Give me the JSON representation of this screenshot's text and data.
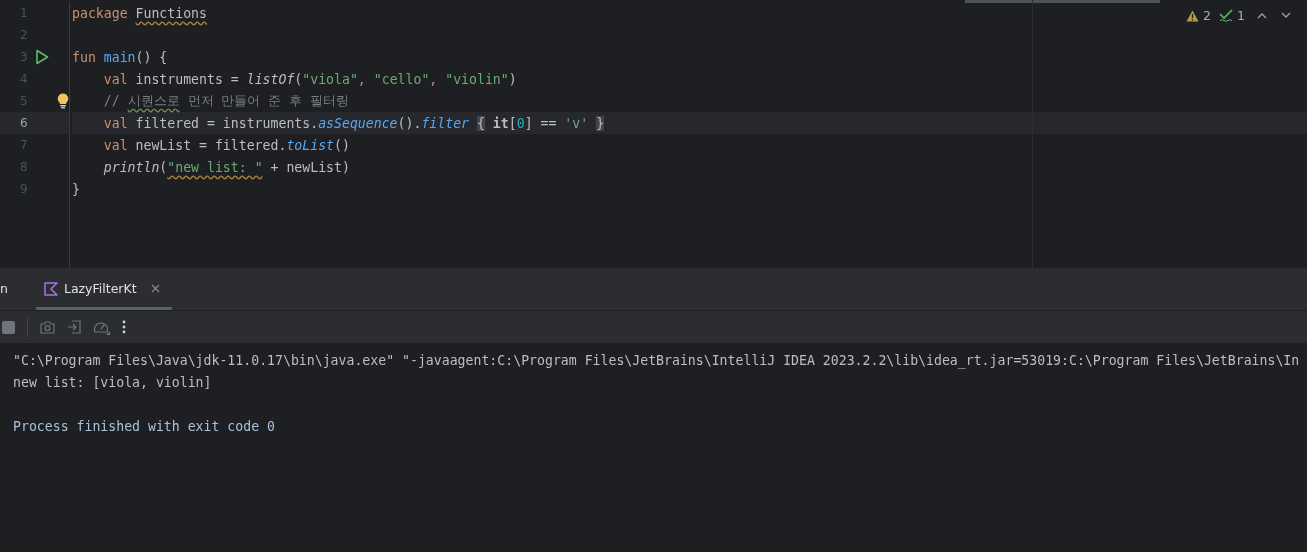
{
  "editor": {
    "inspections": {
      "warnings": "2",
      "weak_warnings": "1"
    },
    "lines": [
      {
        "number": "1",
        "current": false,
        "run_marker": false,
        "hint_bulb": false,
        "tokens": [
          {
            "text": "package ",
            "kind": "kw"
          },
          {
            "text": "Functions",
            "kind": "warned"
          }
        ]
      },
      {
        "number": "2",
        "current": false,
        "run_marker": false,
        "hint_bulb": false
      },
      {
        "number": "3",
        "current": false,
        "run_marker": true,
        "hint_bulb": false,
        "tokens": [
          {
            "text": "fun ",
            "kind": "kw"
          },
          {
            "text": "main",
            "kind": "decl"
          },
          {
            "text": "() {",
            "kind": "plain"
          }
        ]
      },
      {
        "number": "4",
        "current": false,
        "run_marker": false,
        "hint_bulb": false,
        "tokens": [
          {
            "text": "    val ",
            "kind": "kw"
          },
          {
            "text": "instruments = ",
            "kind": "plain"
          },
          {
            "text": "listOf",
            "kind": "call"
          },
          {
            "text": "(",
            "kind": "plain"
          },
          {
            "text": "\"viola\"",
            "kind": "str"
          },
          {
            "text": ", ",
            "kind": "kw"
          },
          {
            "text": "\"cello\"",
            "kind": "str"
          },
          {
            "text": ", ",
            "kind": "kw"
          },
          {
            "text": "\"violin\"",
            "kind": "str"
          },
          {
            "text": ")",
            "kind": "plain"
          }
        ]
      },
      {
        "number": "5",
        "current": false,
        "run_marker": false,
        "hint_bulb": true,
        "tokens": [
          {
            "text": "    // ",
            "kind": "comment"
          },
          {
            "text": "시퀀스로",
            "kind": "commenttypo"
          },
          {
            "text": " 먼저 만들어 준 후 필터링",
            "kind": "comment"
          }
        ]
      },
      {
        "number": "6",
        "current": true,
        "run_marker": false,
        "hint_bulb": false,
        "tokens": [
          {
            "text": "    val ",
            "kind": "kw"
          },
          {
            "text": "filtered = instruments.",
            "kind": "plain"
          },
          {
            "text": "asSequence",
            "kind": "ext"
          },
          {
            "text": "().",
            "kind": "plain"
          },
          {
            "text": "filter ",
            "kind": "ext"
          },
          {
            "text": "{",
            "kind": "brace"
          },
          {
            "text": " it",
            "kind": "bold"
          },
          {
            "text": "[",
            "kind": "plain"
          },
          {
            "text": "0",
            "kind": "num"
          },
          {
            "text": "] == ",
            "kind": "plain"
          },
          {
            "text": "'v' ",
            "kind": "str"
          },
          {
            "text": "}",
            "kind": "brace"
          }
        ]
      },
      {
        "number": "7",
        "current": false,
        "run_marker": false,
        "hint_bulb": false,
        "tokens": [
          {
            "text": "    val ",
            "kind": "kw"
          },
          {
            "text": "newList = filtered.",
            "kind": "plain"
          },
          {
            "text": "toList",
            "kind": "ext"
          },
          {
            "text": "()",
            "kind": "plain"
          }
        ]
      },
      {
        "number": "8",
        "current": false,
        "run_marker": false,
        "hint_bulb": false,
        "tokens": [
          {
            "text": "    println",
            "kind": "call"
          },
          {
            "text": "(",
            "kind": "plain"
          },
          {
            "text": "\"new list: \"",
            "kind": "strtypo"
          },
          {
            "text": " + newList)",
            "kind": "plain"
          }
        ]
      },
      {
        "number": "9",
        "current": false,
        "run_marker": false,
        "hint_bulb": false,
        "tokens": [
          {
            "text": "}",
            "kind": "plain"
          }
        ]
      }
    ]
  },
  "run_panel": {
    "tabs": [
      {
        "label": "n",
        "selected": false,
        "closable": false
      },
      {
        "label": "LazyFilterKt",
        "selected": true,
        "closable": true
      }
    ],
    "console": [
      {
        "kind": "command",
        "text": "\"C:\\Program Files\\Java\\jdk-11.0.17\\bin\\java.exe\" \"-javaagent:C:\\Program Files\\JetBrains\\IntelliJ IDEA 2023.2.2\\lib\\idea_rt.jar=53019:C:\\Program Files\\JetBrains\\In"
      },
      {
        "kind": "output",
        "text": "new list: [viola, violin]"
      },
      {
        "kind": "blank"
      },
      {
        "kind": "status",
        "text": "Process finished with exit code 0"
      }
    ]
  }
}
